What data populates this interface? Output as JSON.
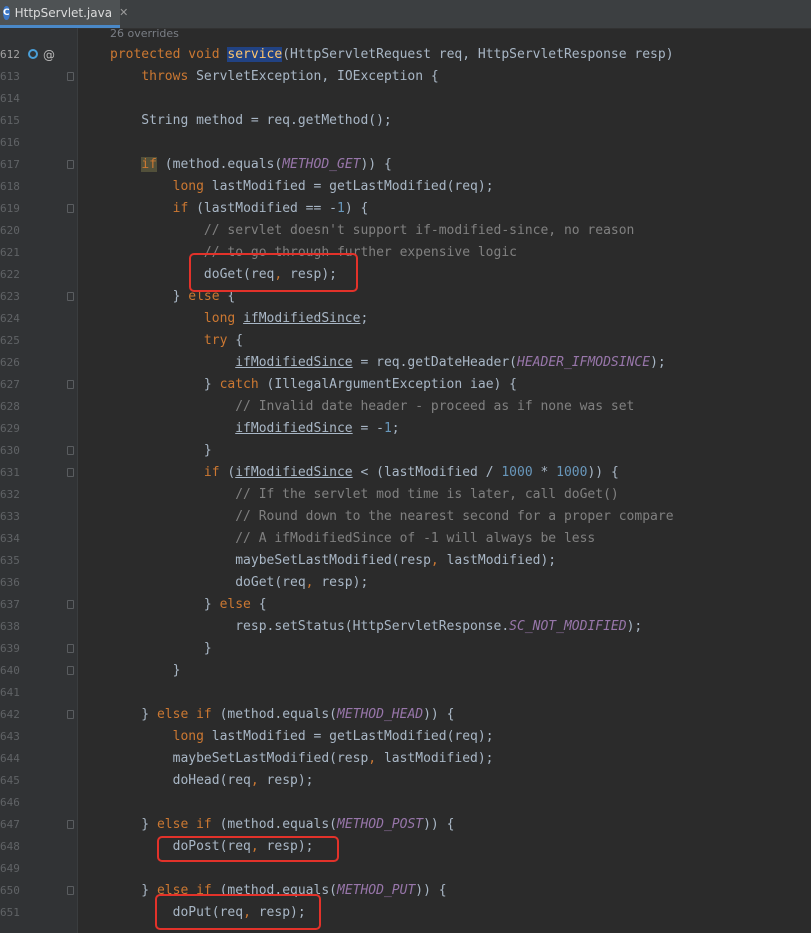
{
  "tab": {
    "label": "HttpServlet.java",
    "icon_letter": "C",
    "close": "✕"
  },
  "hint": "26 overrides",
  "gutter_icons": {
    "override": "@"
  },
  "lines": [
    {
      "n": "612",
      "segs": [
        [
          "kw",
          "protected void "
        ],
        [
          "meth-hl",
          "service"
        ],
        [
          "",
          "(HttpServletRequest req, HttpServletResponse resp)"
        ]
      ]
    },
    {
      "n": "613",
      "segs": [
        [
          "",
          "    "
        ],
        [
          "kw",
          "throws "
        ],
        [
          "",
          "ServletException, IOException {"
        ]
      ]
    },
    {
      "n": "614",
      "segs": []
    },
    {
      "n": "615",
      "segs": [
        [
          "",
          "    String method = req.getMethod();"
        ]
      ]
    },
    {
      "n": "616",
      "segs": []
    },
    {
      "n": "617",
      "segs": [
        [
          "",
          "    "
        ],
        [
          "kw-hl",
          "if"
        ],
        [
          "",
          " (method.equals("
        ],
        [
          "const",
          "METHOD_GET"
        ],
        [
          "",
          ")) {"
        ]
      ]
    },
    {
      "n": "618",
      "segs": [
        [
          "",
          "        "
        ],
        [
          "kw",
          "long "
        ],
        [
          "",
          "lastModified = getLastModified(req);"
        ]
      ]
    },
    {
      "n": "619",
      "segs": [
        [
          "",
          "        "
        ],
        [
          "kw",
          "if "
        ],
        [
          "",
          "(lastModified == -"
        ],
        [
          "num",
          "1"
        ],
        [
          "",
          ") {"
        ]
      ]
    },
    {
      "n": "620",
      "segs": [
        [
          "cmt",
          "            // servlet doesn't support if-modified-since, no reason"
        ]
      ]
    },
    {
      "n": "621",
      "segs": [
        [
          "cmt",
          "            // to go through further expensive logic"
        ]
      ]
    },
    {
      "n": "622",
      "segs": [
        [
          "",
          "            doGet(req"
        ],
        [
          "kw",
          ", "
        ],
        [
          "",
          "resp);"
        ]
      ]
    },
    {
      "n": "623",
      "segs": [
        [
          "",
          "        } "
        ],
        [
          "kw",
          "else "
        ],
        [
          "",
          "{"
        ]
      ]
    },
    {
      "n": "624",
      "segs": [
        [
          "",
          "            "
        ],
        [
          "kw",
          "long "
        ],
        [
          "fieldu",
          "ifModifiedSince"
        ],
        [
          "",
          ";"
        ]
      ]
    },
    {
      "n": "625",
      "segs": [
        [
          "",
          "            "
        ],
        [
          "kw",
          "try "
        ],
        [
          "",
          "{"
        ]
      ]
    },
    {
      "n": "626",
      "segs": [
        [
          "",
          "                "
        ],
        [
          "fieldu",
          "ifModifiedSince"
        ],
        [
          "",
          " = req.getDateHeader("
        ],
        [
          "const",
          "HEADER_IFMODSINCE"
        ],
        [
          "",
          ");"
        ]
      ]
    },
    {
      "n": "627",
      "segs": [
        [
          "",
          "            } "
        ],
        [
          "kw",
          "catch "
        ],
        [
          "",
          "(IllegalArgumentException iae) {"
        ]
      ]
    },
    {
      "n": "628",
      "segs": [
        [
          "cmt",
          "                // Invalid date header - proceed as if none was set"
        ]
      ]
    },
    {
      "n": "629",
      "segs": [
        [
          "",
          "                "
        ],
        [
          "fieldu",
          "ifModifiedSince"
        ],
        [
          "",
          " = -"
        ],
        [
          "num",
          "1"
        ],
        [
          "",
          ";"
        ]
      ]
    },
    {
      "n": "630",
      "segs": [
        [
          "",
          "            }"
        ]
      ]
    },
    {
      "n": "631",
      "segs": [
        [
          "",
          "            "
        ],
        [
          "kw",
          "if "
        ],
        [
          "",
          "("
        ],
        [
          "fieldu",
          "ifModifiedSince"
        ],
        [
          "",
          " < (lastModified / "
        ],
        [
          "num",
          "1000"
        ],
        [
          "",
          " * "
        ],
        [
          "num",
          "1000"
        ],
        [
          "",
          ")) {"
        ]
      ]
    },
    {
      "n": "632",
      "segs": [
        [
          "cmt",
          "                // If the servlet mod time is later, call doGet()"
        ]
      ]
    },
    {
      "n": "633",
      "segs": [
        [
          "cmt",
          "                // Round down to the nearest second for a proper compare"
        ]
      ]
    },
    {
      "n": "634",
      "segs": [
        [
          "cmt",
          "                // A ifModifiedSince of -1 will always be less"
        ]
      ]
    },
    {
      "n": "635",
      "segs": [
        [
          "",
          "                maybeSetLastModified(resp"
        ],
        [
          "kw",
          ", "
        ],
        [
          "",
          "lastModified);"
        ]
      ]
    },
    {
      "n": "636",
      "segs": [
        [
          "",
          "                doGet(req"
        ],
        [
          "kw",
          ", "
        ],
        [
          "",
          "resp);"
        ]
      ]
    },
    {
      "n": "637",
      "segs": [
        [
          "",
          "            } "
        ],
        [
          "kw",
          "else "
        ],
        [
          "",
          "{"
        ]
      ]
    },
    {
      "n": "638",
      "segs": [
        [
          "",
          "                resp.setStatus(HttpServletResponse."
        ],
        [
          "const",
          "SC_NOT_MODIFIED"
        ],
        [
          "",
          ");"
        ]
      ]
    },
    {
      "n": "639",
      "segs": [
        [
          "",
          "            }"
        ]
      ]
    },
    {
      "n": "640",
      "segs": [
        [
          "",
          "        }"
        ]
      ]
    },
    {
      "n": "641",
      "segs": []
    },
    {
      "n": "642",
      "segs": [
        [
          "",
          "    } "
        ],
        [
          "kw",
          "else if "
        ],
        [
          "",
          "(method.equals("
        ],
        [
          "const",
          "METHOD_HEAD"
        ],
        [
          "",
          ")) {"
        ]
      ]
    },
    {
      "n": "643",
      "segs": [
        [
          "",
          "        "
        ],
        [
          "kw",
          "long "
        ],
        [
          "",
          "lastModified = getLastModified(req);"
        ]
      ]
    },
    {
      "n": "644",
      "segs": [
        [
          "",
          "        maybeSetLastModified(resp"
        ],
        [
          "kw",
          ", "
        ],
        [
          "",
          "lastModified);"
        ]
      ]
    },
    {
      "n": "645",
      "segs": [
        [
          "",
          "        doHead(req"
        ],
        [
          "kw",
          ", "
        ],
        [
          "",
          "resp);"
        ]
      ]
    },
    {
      "n": "646",
      "segs": []
    },
    {
      "n": "647",
      "segs": [
        [
          "",
          "    } "
        ],
        [
          "kw",
          "else if "
        ],
        [
          "",
          "(method.equals("
        ],
        [
          "const",
          "METHOD_POST"
        ],
        [
          "",
          ")) {"
        ]
      ]
    },
    {
      "n": "648",
      "segs": [
        [
          "",
          "        doPost(req"
        ],
        [
          "kw",
          ", "
        ],
        [
          "",
          "resp);"
        ]
      ]
    },
    {
      "n": "649",
      "segs": []
    },
    {
      "n": "650",
      "segs": [
        [
          "",
          "    } "
        ],
        [
          "kw",
          "else if "
        ],
        [
          "",
          "(method.equals("
        ],
        [
          "const",
          "METHOD_PUT"
        ],
        [
          "",
          ")) {"
        ]
      ]
    },
    {
      "n": "651",
      "segs": [
        [
          "",
          "        doPut(req"
        ],
        [
          "kw",
          ", "
        ],
        [
          "",
          "resp);"
        ]
      ]
    }
  ],
  "colors": {
    "background": "#2b2b2b",
    "keyword": "#cc7832",
    "constant": "#9876aa",
    "comment": "#808080",
    "number": "#6897bb",
    "highlight_box": "#e2322a"
  }
}
